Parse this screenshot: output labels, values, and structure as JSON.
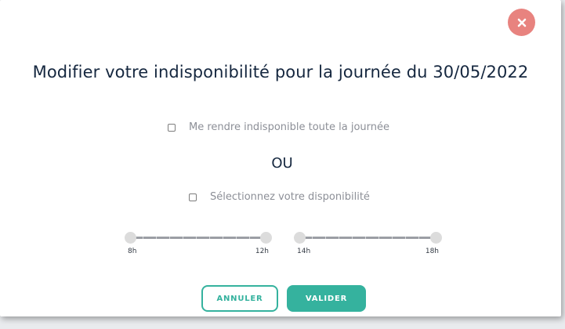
{
  "modal": {
    "title": "Modifier votre indisponibilité pour la journée du 30/05/2022",
    "close_icon": "close-icon",
    "option_full_day_label": "Me rendre indisponible toute la journée",
    "separator_label": "OU",
    "option_select_label": "Sélectionnez votre disponibilité",
    "slider_morning": {
      "min_label": "8h",
      "max_label": "12h"
    },
    "slider_afternoon": {
      "min_label": "14h",
      "max_label": "18h"
    },
    "cancel_label": "ANNULER",
    "validate_label": "VALIDER",
    "colors": {
      "accent": "#35b29e",
      "close": "#e8837f",
      "title": "#15273f"
    }
  }
}
